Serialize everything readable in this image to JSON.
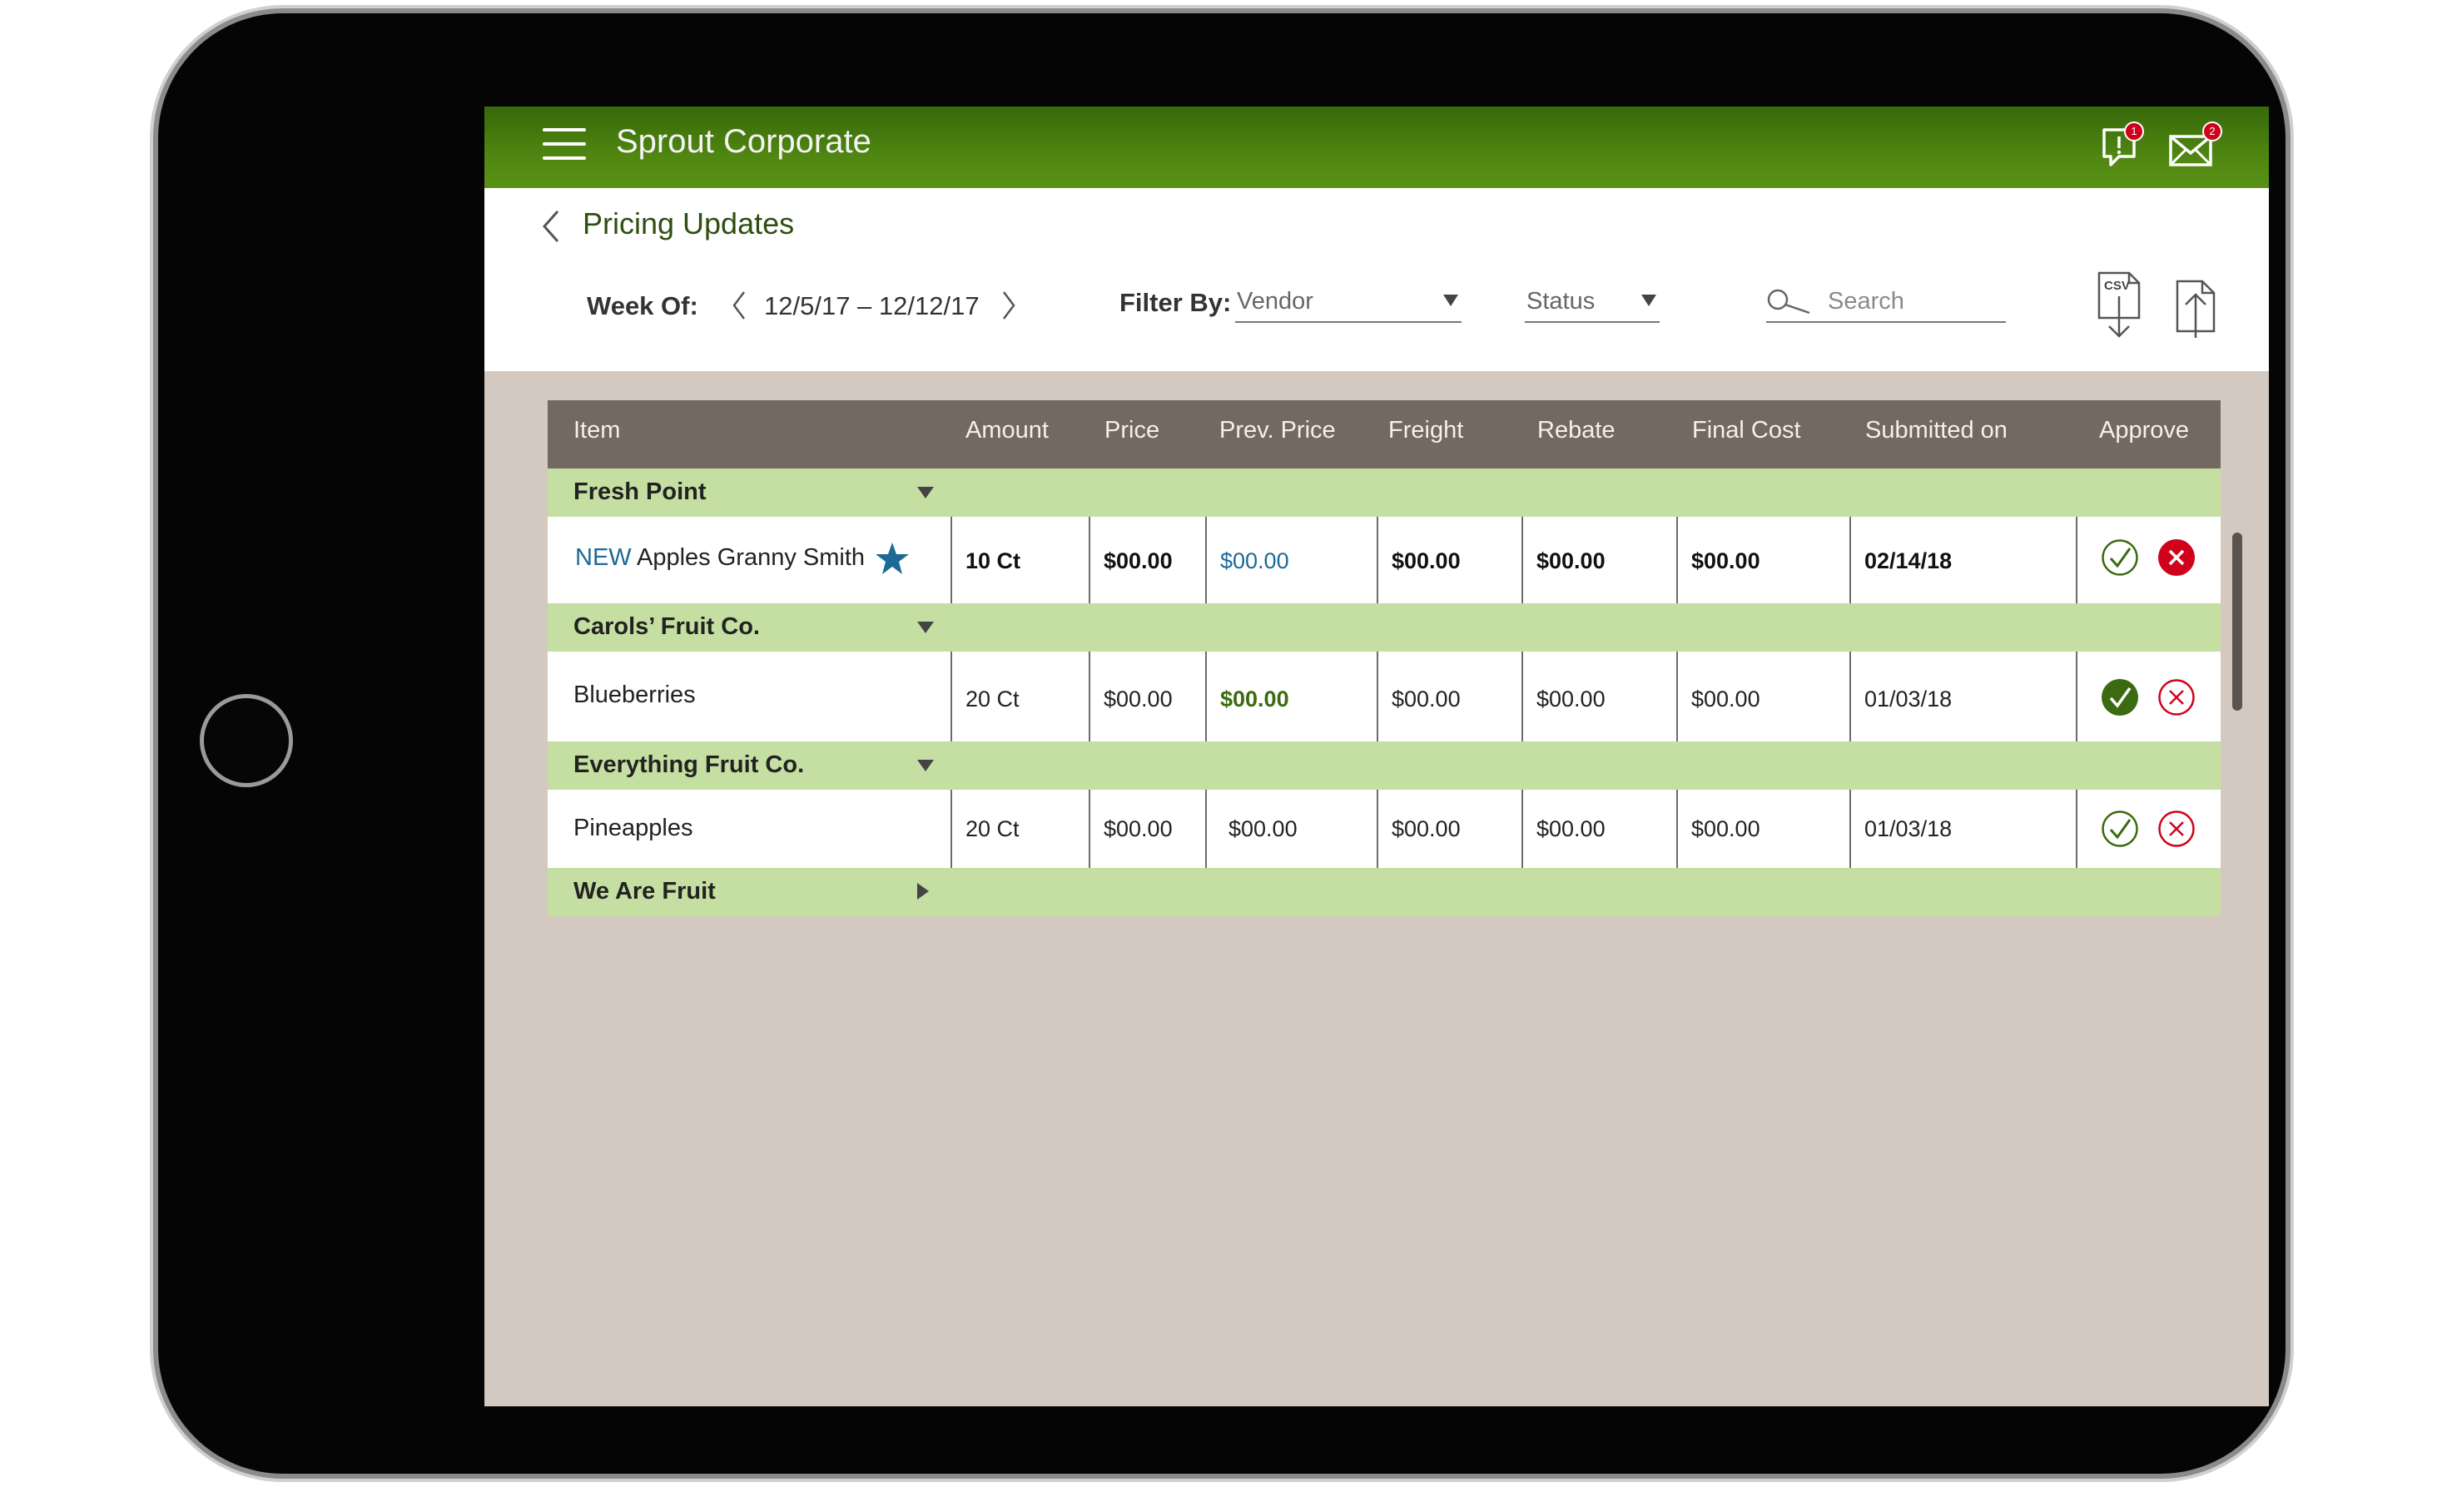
{
  "app": {
    "title": "Sprout Corporate",
    "brand_color": "#4f8611",
    "alerts_badge": "1",
    "messages_badge": "2"
  },
  "page": {
    "title": "Pricing Updates"
  },
  "week": {
    "label": "Week Of:",
    "range": "12/5/17 – 12/12/17"
  },
  "filter": {
    "label": "Filter By:",
    "vendor_value": "Vendor",
    "status_value": "Status"
  },
  "search": {
    "placeholder": "Search"
  },
  "toolbar": {
    "csv_label": "CSV"
  },
  "table": {
    "columns": [
      "Item",
      "Amount",
      "Price",
      "Prev. Price",
      "Freight",
      "Rebate",
      "Final Cost",
      "Submitted on",
      "Approve"
    ],
    "groups": [
      {
        "name": "Fresh Point",
        "expanded": true,
        "rows": [
          {
            "tag": "NEW",
            "item": "Apples Granny Smith",
            "starred": true,
            "amount": "10 Ct",
            "price": "$00.00",
            "prev_price": "$00.00",
            "freight": "$00.00",
            "rebate": "$00.00",
            "final_cost": "$00.00",
            "submitted_on": "02/14/18",
            "approved": false,
            "rejected": true
          }
        ]
      },
      {
        "name": "Carols’ Fruit Co.",
        "expanded": true,
        "rows": [
          {
            "item": "Blueberries",
            "amount": "20 Ct",
            "price": "$00.00",
            "prev_price": "$00.00",
            "freight": "$00.00",
            "rebate": "$00.00",
            "final_cost": "$00.00",
            "submitted_on": "01/03/18",
            "approved": true,
            "rejected": false
          }
        ]
      },
      {
        "name": "Everything Fruit Co.",
        "expanded": true,
        "rows": [
          {
            "item": "Pineapples",
            "amount": "20 Ct",
            "price": "$00.00",
            "prev_price": "$00.00",
            "freight": "$00.00",
            "rebate": "$00.00",
            "final_cost": "$00.00",
            "submitted_on": "01/03/18",
            "approved": false,
            "rejected": false
          }
        ]
      },
      {
        "name": "We Are Fruit",
        "expanded": false,
        "rows": []
      }
    ]
  },
  "icons": {
    "menu": "hamburger-icon",
    "alerts": "alert-icon",
    "messages": "mail-icon",
    "back": "chevron-left-icon",
    "search": "search-icon",
    "csv": "csv-download-icon",
    "upload": "upload-icon",
    "star": "star-icon",
    "approve": "check-circle-icon",
    "reject": "x-circle-icon"
  },
  "colors": {
    "header_row": "#746960",
    "group_row": "#c5dfa2",
    "content_bg": "#d4c9c0",
    "approve": "#3b6b10",
    "reject": "#d0021b",
    "new_tag": "#1c6a95"
  }
}
